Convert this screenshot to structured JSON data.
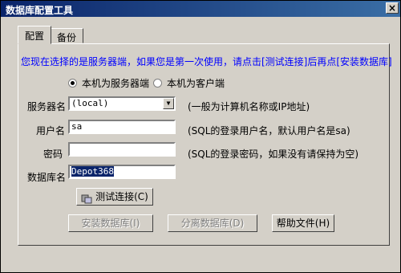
{
  "window": {
    "title": "数据库配置工具",
    "close_glyph": "×"
  },
  "tabs": [
    {
      "label": "配置"
    },
    {
      "label": "备份"
    }
  ],
  "info_text": "您现在选择的是服务器端，如果您是第一次使用，请点击[测试连接]后再点[安装数据库]",
  "radio": {
    "server": "本机为服务器端",
    "client": "本机为客户端",
    "selected": "server"
  },
  "form": {
    "server_label": "服务器名",
    "server_value": "(local)",
    "server_hint": "(一般为计算机名称或IP地址)",
    "user_label": "用户名",
    "user_value": "sa",
    "user_hint": "(SQL的登录用户名，默认用户名是sa)",
    "password_label": "密码",
    "password_value": "",
    "password_hint": "(SQL的登录密码，如果没有请保持为空)",
    "db_label": "数据库名",
    "db_value": "Depot368"
  },
  "buttons": {
    "test": "测试连接(C)",
    "install": "安装数据库(I)",
    "detach": "分离数据库(D)",
    "help": "帮助文件(H)"
  },
  "colors": {
    "title_start": "#0a246a",
    "title_end": "#3a6ea5",
    "info": "#0000ff",
    "face": "#d4d0c8"
  }
}
